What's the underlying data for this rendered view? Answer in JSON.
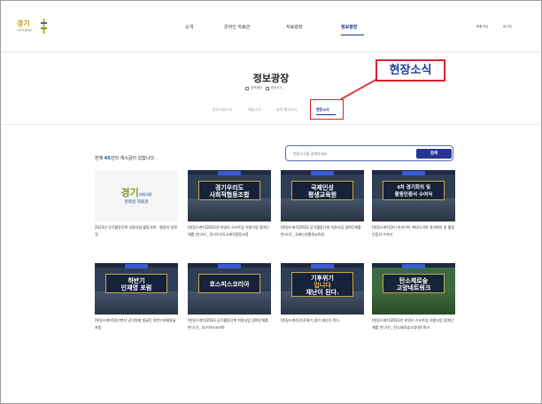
{
  "header": {
    "logo_text": "경기",
    "logo_sub": "사회적경제원",
    "nav": [
      "소개",
      "온라인 자료관",
      "자료광장",
      "정보광장"
    ],
    "active_nav": "정보광장",
    "util": [
      "회원가입",
      "로그인"
    ]
  },
  "hero": {
    "title": "정보광장",
    "breadcrumb": [
      "정보광장",
      "현장소식"
    ],
    "subtabs": [
      "공모사업소식",
      "채용소식",
      "교육 행사소식",
      "현장소식"
    ],
    "active_subtab": "현장소식"
  },
  "annotation": {
    "label": "현장소식",
    "color": "#e0202a"
  },
  "listing": {
    "count_prefix": "전체",
    "count": "45",
    "count_suffix": "건의 게시글이 있습니다.",
    "search_placeholder": "현장소식을 검색하세요.",
    "search_button": "검색"
  },
  "cards": [
    {
      "thumb_style": "light",
      "thumb_title": "경기",
      "thumb_title_small": "사회사회",
      "thumb_sub": "온라인 자료관",
      "caption": "2023년 공익활동단체 지원사업 활동사례 - 행권의 날갯짓"
    },
    {
      "thumb_style": "dark",
      "thumb_lines": [
        "경기우리도",
        "사회적협동조합"
      ],
      "caption": "[현장스케치]2023년 비영리 스타트업 지원사업 참여단체를 만나다!_ 경기우리도사회적협동조합"
    },
    {
      "thumb_style": "dark",
      "thumb_lines": [
        "국제인성",
        "평생교육원"
      ],
      "caption": "[현장스케치]2023 공익활동단체 지원사업 참여단체를 만나다!_ 국제인성평생교육원"
    },
    {
      "thumb_style": "dark",
      "thumb_lines": [
        "4차 경기회의 및",
        "활동인증서 수여식"
      ],
      "caption": "[현장스케치]3기 마카이브 에디터 4차 경기회의 및 활동인증서 수여식"
    },
    {
      "thumb_style": "dark",
      "thumb_lines": [
        "하반기",
        "인재영 포럼"
      ],
      "caption": "[현장스케치]경기북부 공익의제 발굴단 하반기의제발굴포럼"
    },
    {
      "thumb_style": "dark",
      "thumb_lines": [
        "호스피스코리아"
      ],
      "caption": "[현장스케치]2023 공익활동단체 지원사업 참여단체를 만나다!_ 호스피스코리아"
    },
    {
      "thumb_style": "dark",
      "thumb_lines": [
        "기후위기",
        "입니다",
        "재난이 된다."
      ],
      "caption": "[현장스케치]기후위기 없이 재난이 된다."
    },
    {
      "thumb_style": "green",
      "thumb_lines": [
        "탄소제로숲",
        "고양네트워크"
      ],
      "caption": "[현장스케치]2023년 비영리 스타트업 지원사업 참여단체를 만나다!_ 탄소제로숲고양네트워크"
    }
  ]
}
